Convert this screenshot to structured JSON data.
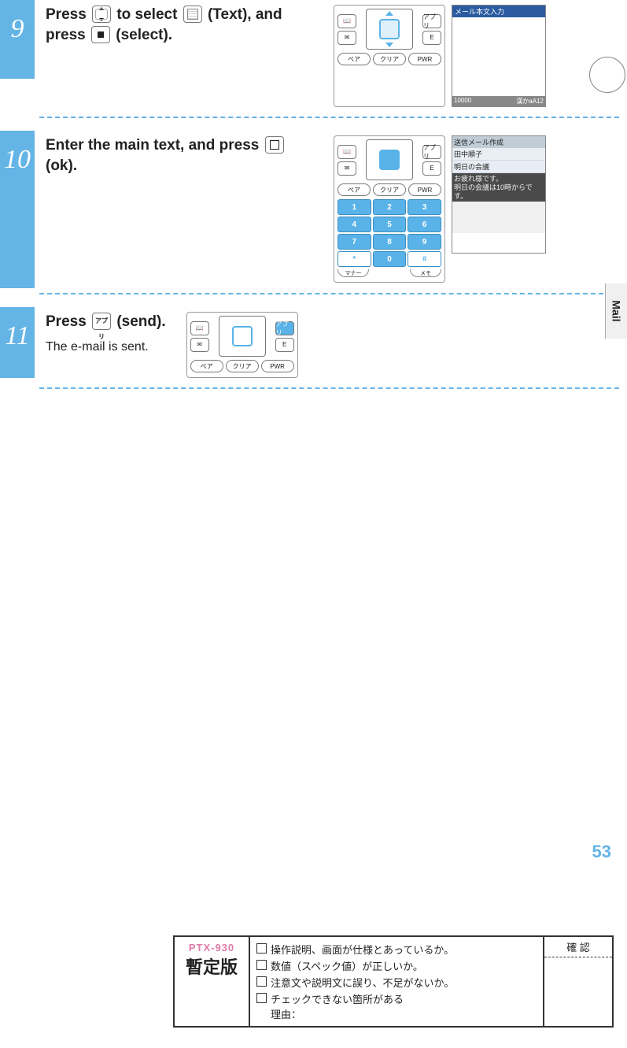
{
  "sidebar_tab": "Mail",
  "page_number": "53",
  "steps": [
    {
      "num": "9",
      "text_parts": {
        "a": "Press ",
        "b": " to select ",
        "c": " (Text), and press ",
        "d": " (select)."
      },
      "screen": {
        "title": "メール本文入力",
        "footer_left": "10000",
        "footer_right": "漢かaA12"
      }
    },
    {
      "num": "10",
      "text_parts": {
        "a": "Enter the main text, and press ",
        "b": " (ok)."
      },
      "keypad": [
        "1",
        "2",
        "3",
        "4",
        "5",
        "6",
        "7",
        "8",
        "9",
        "*",
        "0",
        "#"
      ],
      "ctrl": {
        "pair": "ペア",
        "clear": "クリア",
        "pwr": "PWR"
      },
      "arcs": {
        "left": "マナー",
        "right": "メモ"
      },
      "screen2": {
        "header": "送信メール作成",
        "to": "田中順子",
        "subject": "明日の会議",
        "body_dark": "お疲れ様です。\n明日の会議は10時からです。"
      }
    },
    {
      "num": "11",
      "text_parts": {
        "a": "Press ",
        "b": " (send)."
      },
      "sub": "The e-mail is sent.",
      "app_label": "アプリ"
    }
  ],
  "phone_softkeys": {
    "book": "📖",
    "mail": "✉",
    "app": "アプリ",
    "e": "E"
  },
  "review": {
    "model": "PTX-930",
    "stamp": "暫定版",
    "items": [
      "操作説明、画面が仕様とあっているか。",
      "数値（スペック値）が正しいか。",
      "注意文や説明文に誤り、不足がないか。",
      "チェックできない箇所がある\n理由："
    ],
    "confirm": "確 認"
  }
}
